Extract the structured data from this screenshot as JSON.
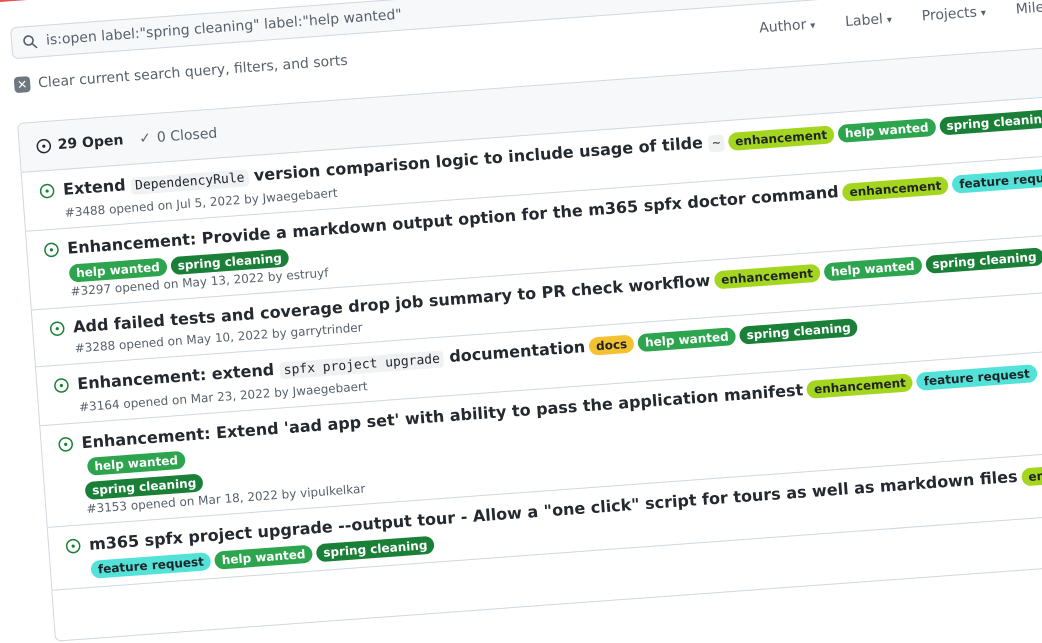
{
  "search": {
    "value": "is:open label:\"spring cleaning\" label:\"help wanted\""
  },
  "clear_label": "Clear current search query, filters, and sorts",
  "filters": [
    "Author",
    "Label",
    "Projects",
    "Milestones"
  ],
  "header": {
    "open": "29 Open",
    "closed": "0 Closed"
  },
  "colors": {
    "enhancement": "#a2eeef",
    "enhancement_bg": "#a4d61f",
    "help wanted": "#2da44e",
    "spring cleaning": "#1a7f37",
    "feature request": "#53e2d8",
    "docs": "#f2c230"
  },
  "issues": [
    {
      "title_parts": [
        {
          "t": "Extend "
        },
        {
          "c": "DependencyRule"
        },
        {
          "t": " version comparison logic to include usage of tilde "
        },
        {
          "c": "~"
        }
      ],
      "labels": [
        "enhancement",
        "help wanted",
        "spring cleaning"
      ],
      "labels_newline": false,
      "meta": "#3488 opened on Jul 5, 2022 by Jwaegebaert"
    },
    {
      "title_parts": [
        {
          "t": "Enhancement: Provide a markdown output option for the m365 spfx doctor command"
        }
      ],
      "labels": [
        "enhancement",
        "feature request",
        "help wanted",
        "spring cleaning"
      ],
      "labels_newline": true,
      "inline_count": 2,
      "meta": "#3297 opened on May 13, 2022 by estruyf"
    },
    {
      "title_parts": [
        {
          "t": "Add failed tests and coverage drop job summary to PR check workflow"
        }
      ],
      "labels": [
        "enhancement",
        "help wanted",
        "spring cleaning"
      ],
      "labels_newline": false,
      "meta": "#3288 opened on May 10, 2022 by garrytrinder"
    },
    {
      "title_parts": [
        {
          "t": "Enhancement: extend "
        },
        {
          "c": "spfx project upgrade"
        },
        {
          "t": " documentation"
        }
      ],
      "labels": [
        "docs",
        "help wanted",
        "spring cleaning"
      ],
      "labels_newline": false,
      "meta": "#3164 opened on Mar 23, 2022 by Jwaegebaert"
    },
    {
      "title_parts": [
        {
          "t": "Enhancement: Extend 'aad app set' with ability to pass the application manifest"
        }
      ],
      "labels": [
        "enhancement",
        "feature request",
        "help wanted",
        "spring cleaning"
      ],
      "labels_newline": true,
      "inline_count": 3,
      "meta": "#3153 opened on Mar 18, 2022 by vipulkelkar"
    },
    {
      "title_parts": [
        {
          "t": "m365 spfx project upgrade --output tour - Allow a \"one click\" script for tours as well as markdown files"
        }
      ],
      "labels": [
        "enhancement",
        "feature request",
        "help wanted",
        "spring cleaning"
      ],
      "labels_newline": true,
      "inline_count": 1,
      "meta": ""
    }
  ]
}
